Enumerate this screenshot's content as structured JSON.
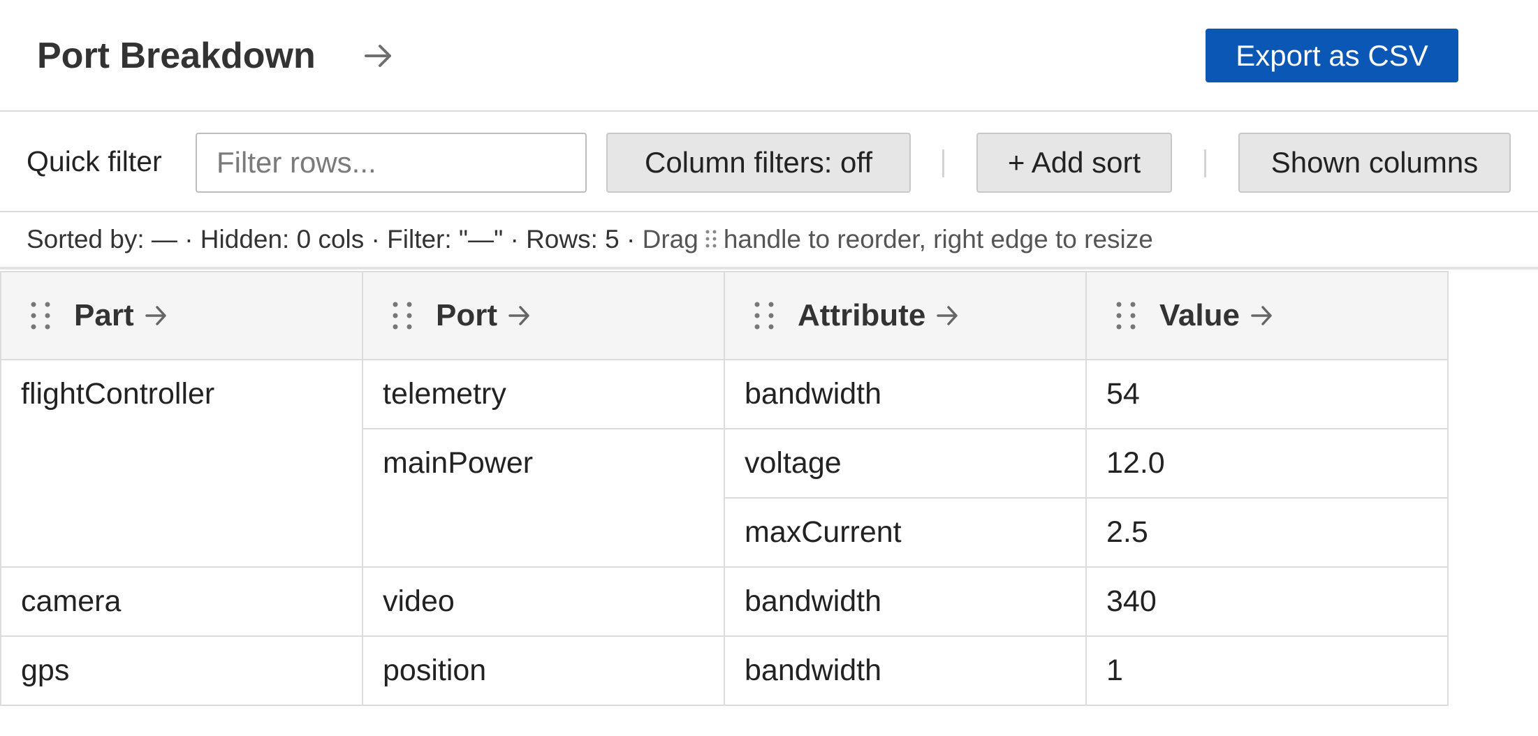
{
  "header": {
    "title": "Port Breakdown",
    "title_arrow_icon": "arrow-right-icon",
    "export_label": "Export as CSV"
  },
  "toolbar": {
    "quick_filter_label": "Quick filter",
    "quick_filter_placeholder": "Filter rows...",
    "quick_filter_value": "",
    "column_filters_label": "Column filters: off",
    "add_sort_label": "+ Add sort",
    "shown_columns_label": "Shown columns"
  },
  "status": {
    "summary": "Sorted by: — · Hidden: 0 cols · Filter: \"—\" · Rows: 5 · ",
    "hint_pre": "Drag",
    "hint_post": "handle to reorder, right edge to resize",
    "grip_icon": "drag-handle-icon"
  },
  "table": {
    "columns": [
      {
        "label": "Part"
      },
      {
        "label": "Port"
      },
      {
        "label": "Attribute"
      },
      {
        "label": "Value"
      }
    ],
    "rows": [
      {
        "part": "flightController",
        "port": "telemetry",
        "attribute": "bandwidth",
        "value": "54"
      },
      {
        "part": "",
        "port": "mainPower",
        "attribute": "voltage",
        "value": "12.0"
      },
      {
        "part": "",
        "port": "",
        "attribute": "maxCurrent",
        "value": "2.5"
      },
      {
        "part": "camera",
        "port": "video",
        "attribute": "bandwidth",
        "value": "340"
      },
      {
        "part": "gps",
        "port": "position",
        "attribute": "bandwidth",
        "value": "1"
      }
    ]
  },
  "colors": {
    "accent": "#0a57b5",
    "header_bg": "#f5f5f5",
    "border": "#dcdcdc",
    "button_bg": "#e6e6e6"
  }
}
